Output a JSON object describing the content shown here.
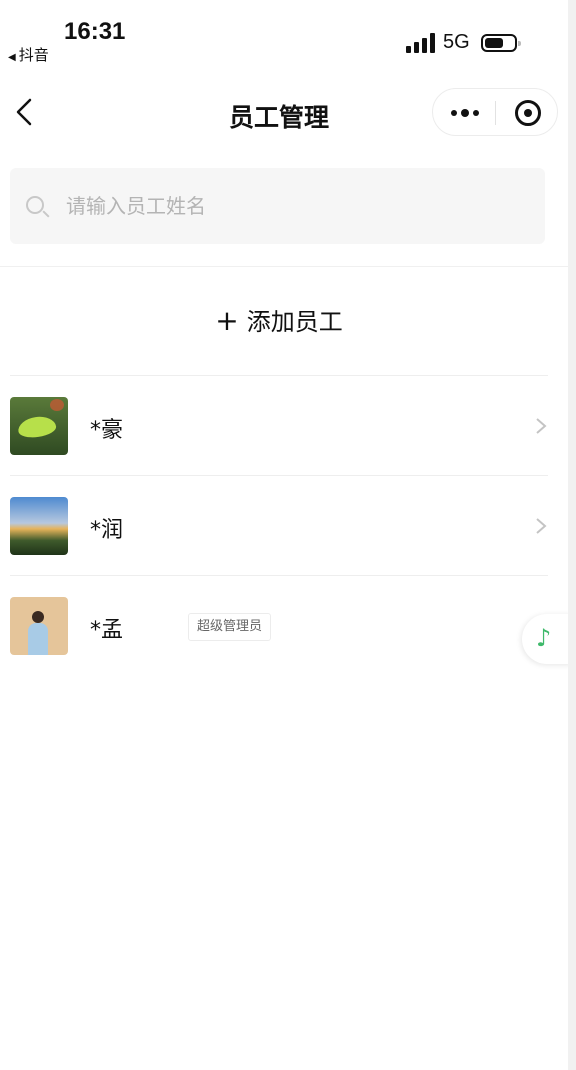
{
  "status_bar": {
    "back_app": "抖音",
    "time": "16:31",
    "network": "5G"
  },
  "nav": {
    "title": "员工管理"
  },
  "search": {
    "placeholder": "请输入员工姓名",
    "value": ""
  },
  "add_button": {
    "label": "添加员工"
  },
  "employees": [
    {
      "name": "*豪",
      "avatar": "leaf-photo-avatar",
      "badge": ""
    },
    {
      "name": "*润",
      "avatar": "mountain-photo-avatar",
      "badge": ""
    },
    {
      "name": "*孟",
      "avatar": "person-photo-avatar",
      "badge": "超级管理员"
    }
  ],
  "icons": {
    "back": "chevron-left-icon",
    "more": "more-dots-icon",
    "close": "target-circle-icon",
    "search": "search-icon",
    "chevron": "chevron-right-icon",
    "music": "music-note-icon"
  },
  "colors": {
    "accent_green": "#3fb96b",
    "search_bg": "#f6f6f6"
  }
}
